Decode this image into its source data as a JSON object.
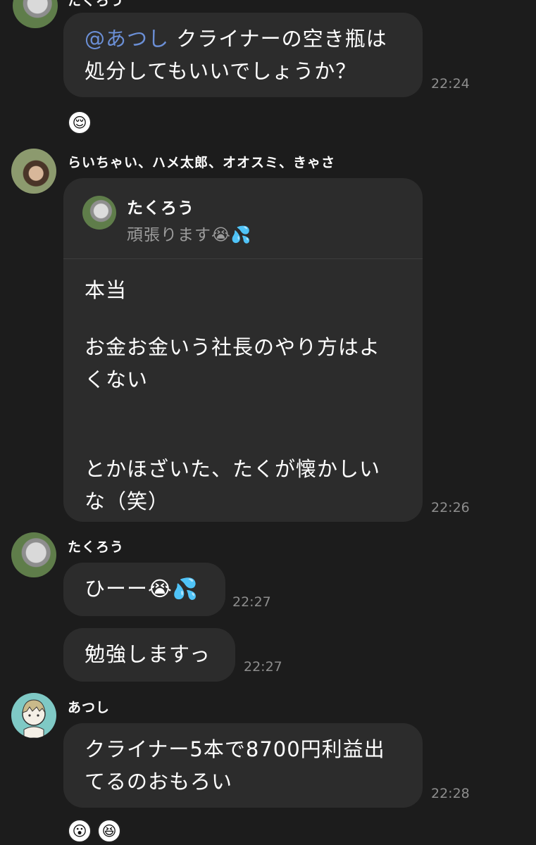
{
  "messages": {
    "m1": {
      "sender": "たくろう",
      "mention": "@あつし",
      "text_line1": " クライナーの空き瓶は",
      "text_line2": "処分してもいいでしょうか？",
      "time": "22:24",
      "reaction": "😌"
    },
    "m2": {
      "sender": "らいちゃい、ハメ太郎、オオスミ、きゃさ",
      "quote_name": "たくろう",
      "quote_text": "頑張ります😭💦",
      "line1": "本当",
      "line2": "お金お金いう社長のやり方はよ",
      "line3": "くない",
      "line4": "とかほざいた、たくが懐かしい",
      "line5": "な（笑）",
      "time": "22:26"
    },
    "m3": {
      "sender": "たくろう",
      "text": "ひーー😭💦",
      "time": "22:27"
    },
    "m4": {
      "text": "勉強しますっ",
      "time": "22:27"
    },
    "m5": {
      "sender": "あつし",
      "line1": "クライナー5本で8700円利益出",
      "line2": "てるのおもろい",
      "time": "22:28",
      "reaction1": "😮",
      "reaction2": "😆"
    }
  }
}
